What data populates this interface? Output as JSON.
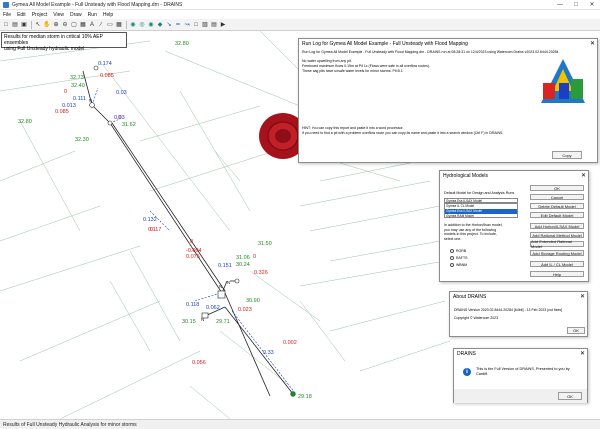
{
  "window": {
    "title": "Gymea All Model Example - Full Unsteady with Flood Mapping.drn - DRAINS",
    "min": "—",
    "max": "□",
    "close": "✕"
  },
  "menu": [
    "File",
    "Edit",
    "Project",
    "View",
    "Draw",
    "Run",
    "Help"
  ],
  "map_note": {
    "line1": "Results for median storm in critical 10% AEP ensembles",
    "line2": "using Full Unsteady hydraulic model"
  },
  "map_labels": {
    "green": [
      "32.80",
      "32.73",
      "32.40",
      "32.80",
      "32.30",
      "31.62",
      "31.50",
      "31.06",
      "30.24",
      "30.15",
      "29.71",
      "30.90",
      "29.18"
    ],
    "red": [
      "0.085",
      "0",
      "0.085",
      "0",
      "0",
      "0.117",
      "0",
      "-0.004",
      "0.075",
      "0",
      "0.326",
      "0.023",
      "0.002",
      "0.056"
    ],
    "blue": [
      "0.174",
      "0.111",
      "0.013",
      "0.03",
      "0.132",
      "0.151",
      "0.062",
      "0.118",
      "0.33"
    ],
    "nodes": [
      "N",
      "N",
      "N",
      "N"
    ]
  },
  "runlog": {
    "title": "Run Log for Gymea All Model Example - Full Unsteady with Flood Mapping",
    "line1": "Run Log for Gymea All Model Example - Full Unsteady with Flood Mapping.drn - DRAINS run at 08:28:31 on 12/4/2023 using Watercom Drains v2023.02.8444.20284",
    "line2": "No water upwelling from any pit.",
    "line3": "Freeboard maximum flows 0.15m at Pit 1c (Flows were safe in all overflow routes).",
    "line4": "These sag pits have unsafe water levels for minor storms: Pit B.1",
    "hint1": "HINT: You can copy this report and paste it into a word processor.",
    "hint2": "If you need to find a pit with a problem overflow route you can copy its name and paste it into a search window (Ctrl F) in DRAINS.",
    "copy": "Copy"
  },
  "hydro": {
    "title": "Hydrological Models",
    "default_label": "Default Model for Design and Analysis Runs",
    "selected": "Gymea Ess ILSAX Model",
    "options": [
      "Gymea IL CL Model",
      "Gymea Ess ILSAX Model",
      "Gymea RAM Model"
    ],
    "info": "In addition to the Horton/Ilsax model, you may use any of the following models in this project. To include, select one.",
    "radios": [
      "RORB",
      "RAFTS",
      "WBNM"
    ],
    "buttons": [
      "OK",
      "Cancel",
      "Delete Default Model",
      "Edit Default Model",
      "Add Horton/ILSAX Model",
      "Add Rational Method Model",
      "Add Extended Rational Model",
      "Add Storage Routing Model",
      "Add IL / CL Model",
      "Help"
    ]
  },
  "about": {
    "title": "About DRAINS",
    "version": "DRAINS Version 2023.02.8444.20284 [64bit] - 13 Feb 2023 [cut fixes]",
    "copyright": "Copyright © Watercom 2023",
    "ok": "OK"
  },
  "message": {
    "title": "DRAINS",
    "text": "This is the Full Version of DRAINS.  Presented to you by Cardiff.",
    "ok": "OK"
  },
  "status": "Results of Full Unsteady Hydraulic Analysis for minor storms",
  "colors": {
    "green": "#1f8a1f",
    "red": "#d11c1c",
    "blue": "#1b3fc0",
    "wax": "#a5121b"
  }
}
